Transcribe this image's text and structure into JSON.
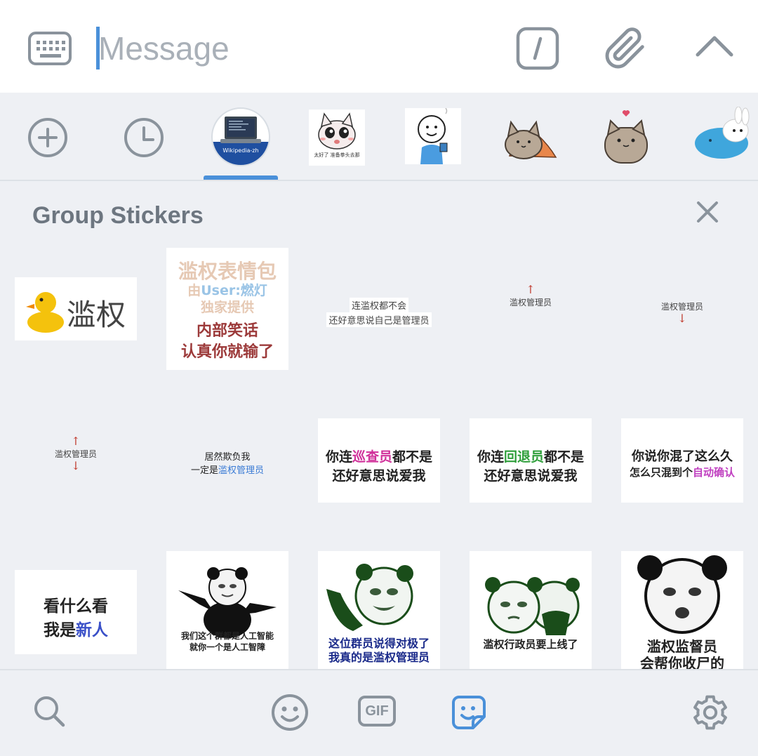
{
  "input": {
    "placeholder": "Message",
    "keyboard_icon": "keyboard-icon",
    "command_icon": "slash-command-icon",
    "attach_icon": "paperclip-icon",
    "expand_icon": "chevron-up-icon"
  },
  "tabs": {
    "add_icon": "plus-circle-icon",
    "recent_icon": "clock-icon",
    "active_tab_label": "Wikipedia-zh",
    "pack2_caption": "太好了 准备拳头去那",
    "active_color": "#4a90d9"
  },
  "section": {
    "title": "Group Stickers",
    "close_icon": "close-icon"
  },
  "stickers": {
    "s1": "滥权",
    "s2_l1": "滥权表情包",
    "s2_l2a": "由",
    "s2_l2b": "User:燃灯",
    "s2_l3": "独家提供",
    "s2_l4": "内部笑话",
    "s2_l5": "认真你就输了",
    "s3_l1": "连滥权都不会",
    "s3_l2": "还好意思说自己是管理员",
    "s4_arrow": "↑",
    "s4_text": "滥权管理员",
    "s5_text": "滥权管理员",
    "s5_arrow": "↓",
    "s6_up": "↑",
    "s6_text": "滥权管理员",
    "s6_down": "↓",
    "s7_l1": "居然欺负我",
    "s7_l2a": "一定是",
    "s7_l2b": "滥权管理员",
    "s8_l1a": "你连",
    "s8_l1b": "巡查员",
    "s8_l1c": "都不是",
    "s8_l2": "还好意思说爱我",
    "s9_l1a": "你连",
    "s9_l1b": "回退员",
    "s9_l1c": "都不是",
    "s9_l2": "还好意思说爱我",
    "s10_l1": "你说你混了这么久",
    "s10_l2a": "怎么只混到个",
    "s10_l2b": "自动确认",
    "s11_l1": "看什么看",
    "s11_l2a": "我是",
    "s11_l2b": "新人",
    "s12_l1": "我们这个群都是人工智能",
    "s12_l2": "就你一个是人工智障",
    "s13_l1": "这位群员说得对极了",
    "s13_l2": "我真的是滥权管理员",
    "s14_l1": "滥权行政员要上线了",
    "s15_l1": "滥权监督员",
    "s15_l2": "会帮你收尸的"
  },
  "bottom": {
    "search_icon": "search-icon",
    "emoji_icon": "emoji-icon",
    "gif_label": "GIF",
    "sticker_icon": "sticker-icon",
    "settings_icon": "gear-icon",
    "active_color": "#4a90d9"
  }
}
